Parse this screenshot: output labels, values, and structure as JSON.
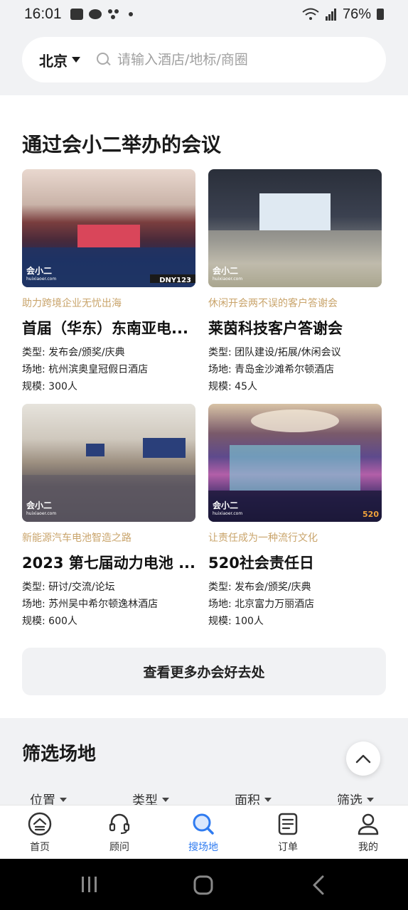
{
  "status_bar": {
    "time": "16:01",
    "battery": "76%"
  },
  "search": {
    "city": "北京",
    "placeholder": "请输入酒店/地标/商圈"
  },
  "section": {
    "title": "通过会小二举办的会议"
  },
  "meetings": [
    {
      "tag": "助力跨境企业无忧出海",
      "name": "首届（华东）东南亚电...",
      "type": "类型: 发布会/颁奖/庆典",
      "venue": "场地: 杭州滨奥皇冠假日酒店",
      "scale": "规模: 300人",
      "logo": "会小二",
      "logo_sub": "huixiaoer.com",
      "overlay": "DNY123"
    },
    {
      "tag": "休闲开会两不误的客户答谢会",
      "name": "莱茵科技客户答谢会",
      "type": "类型: 团队建设/拓展/休闲会议",
      "venue": "场地: 青岛金沙滩希尔顿酒店",
      "scale": "规模: 45人",
      "logo": "会小二",
      "logo_sub": "huixiaoer.com"
    },
    {
      "tag": "新能源汽车电池智造之路",
      "name": "2023 第七届动力电池 ...",
      "type": "类型: 研讨/交流/论坛",
      "venue": "场地: 苏州吴中希尔顿逸林酒店",
      "scale": "规模: 600人",
      "logo": "会小二",
      "logo_sub": "huixiaoer.com"
    },
    {
      "tag": "让责任成为一种流行文化",
      "name": "520社会责任日",
      "type": "类型: 发布会/颁奖/庆典",
      "venue": "场地: 北京富力万丽酒店",
      "scale": "规模: 100人",
      "logo": "会小二",
      "logo_sub": "huixiaoer.com",
      "overlay": "520"
    }
  ],
  "more_button": "查看更多办会好去处",
  "filter": {
    "title": "筛选场地",
    "options": [
      "位置",
      "类型",
      "面积",
      "筛选"
    ]
  },
  "tabs": [
    {
      "label": "首页",
      "icon": "home-icon"
    },
    {
      "label": "顾问",
      "icon": "headset-icon"
    },
    {
      "label": "搜场地",
      "icon": "search-icon"
    },
    {
      "label": "订单",
      "icon": "order-icon"
    },
    {
      "label": "我的",
      "icon": "profile-icon"
    }
  ],
  "colors": {
    "accent": "#2f7bf0",
    "tag": "#c9a46b"
  }
}
